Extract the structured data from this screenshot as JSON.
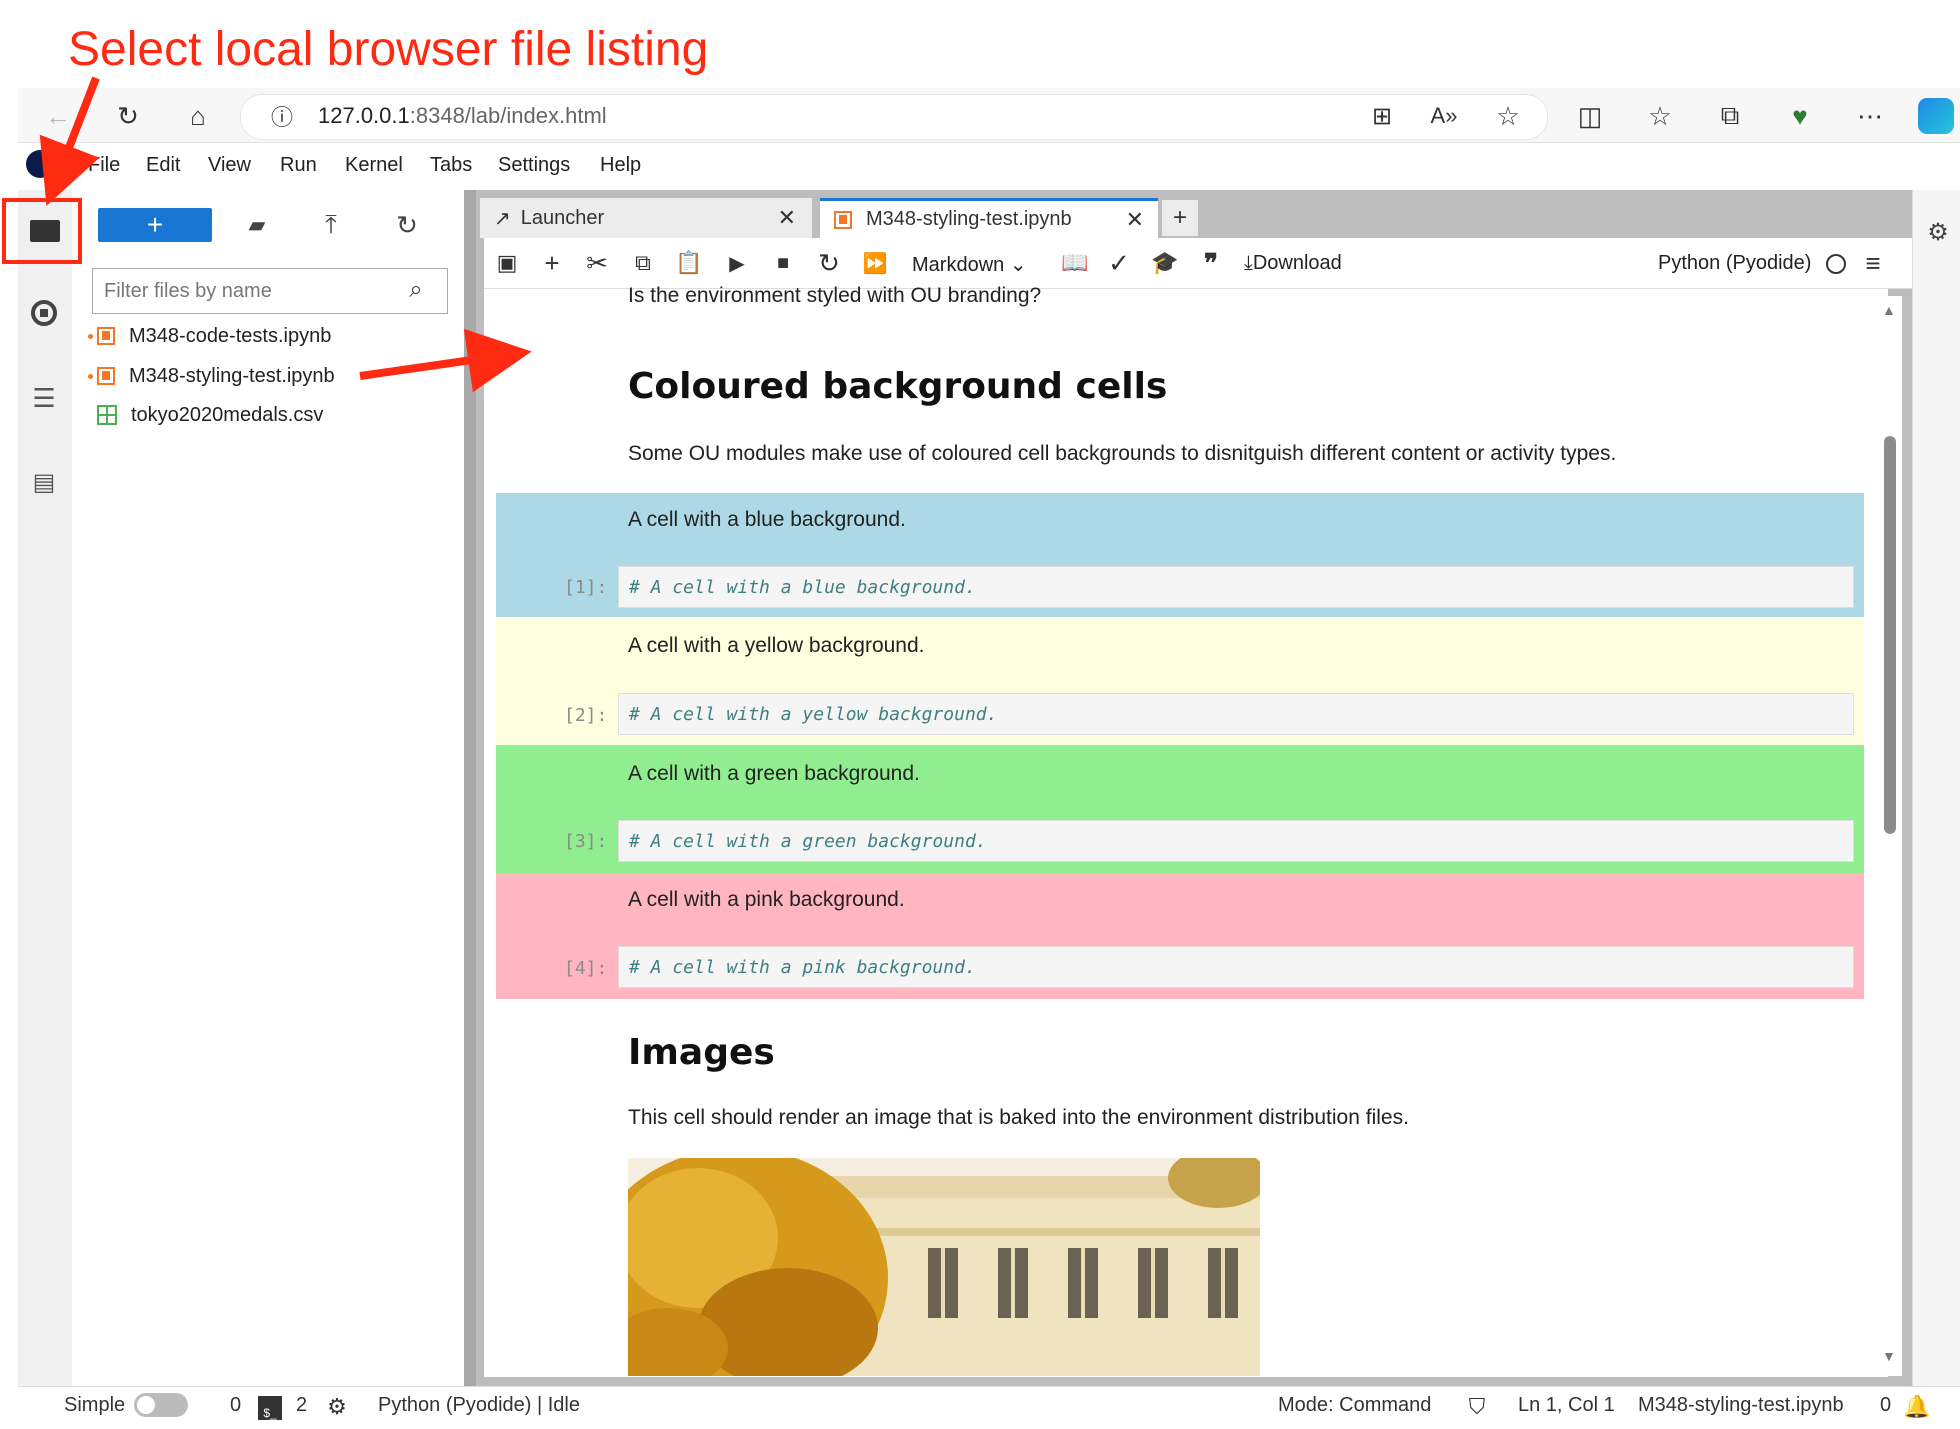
{
  "annotation": {
    "title": "Select local browser file listing",
    "color": "#ff2a12"
  },
  "browser": {
    "url_host": "127.0.0.1",
    "url_path": ":8348/lab/index.html",
    "icons": [
      "back-icon",
      "reload-icon",
      "home-icon",
      "info-icon",
      "apps-icon",
      "read-aloud-icon",
      "favorite-star-icon",
      "split-screen-icon",
      "favorites-icon",
      "collections-icon",
      "browser-essentials-icon",
      "more-icon",
      "copilot-icon"
    ]
  },
  "menu": {
    "items": [
      "File",
      "Edit",
      "View",
      "Run",
      "Kernel",
      "Tabs",
      "Settings",
      "Help"
    ]
  },
  "file_browser": {
    "filter_placeholder": "Filter files by name",
    "files": [
      {
        "name": "M348-code-tests.ipynb",
        "type": "notebook",
        "running": true
      },
      {
        "name": "M348-styling-test.ipynb",
        "type": "notebook",
        "running": true
      },
      {
        "name": "tokyo2020medals.csv",
        "type": "csv",
        "running": false
      }
    ]
  },
  "tabs": [
    {
      "label": "Launcher",
      "active": false
    },
    {
      "label": "M348-styling-test.ipynb",
      "active": true
    }
  ],
  "toolbar": {
    "cell_type": "Markdown",
    "download_label": "Download",
    "kernel_label": "Python (Pyodide)"
  },
  "notebook": {
    "partial_top_text": "Is the environment styled with OU branding?",
    "heading1": "Coloured background cells",
    "intro": "Some OU modules make use of coloured cell backgrounds to disnitguish different content or activity types.",
    "cells": [
      {
        "text": "A cell with a blue background.",
        "prompt": "[1]:",
        "code": "# A cell with a blue background.",
        "color": "#add8e6"
      },
      {
        "text": "A cell with a yellow background.",
        "prompt": "[2]:",
        "code": "# A cell with a yellow background.",
        "color": "#ffffe0"
      },
      {
        "text": "A cell with a green background.",
        "prompt": "[3]:",
        "code": "# A cell with a green background.",
        "color": "#90ee90"
      },
      {
        "text": "A cell with a pink background.",
        "prompt": "[4]:",
        "code": "# A cell with a pink background.",
        "color": "#ffb6c1"
      }
    ],
    "heading2": "Images",
    "images_text": "This cell should render an image that is baked into the environment distribution files."
  },
  "status": {
    "mode_label": "Simple",
    "terminals": "0",
    "kernels": "2",
    "kernel_status": "Python (Pyodide) | Idle",
    "mode": "Mode: Command",
    "cursor": "Ln 1, Col 1",
    "filename": "M348-styling-test.ipynb",
    "notifications": "0"
  }
}
